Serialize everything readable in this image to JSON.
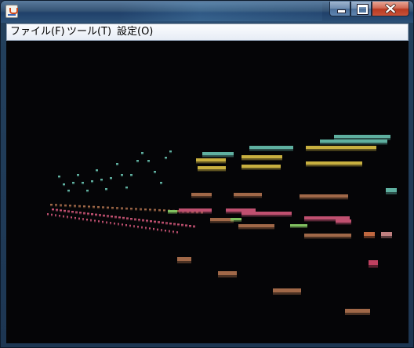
{
  "window": {
    "title": ""
  },
  "menu": {
    "items": [
      {
        "id": "file",
        "label": "ファイル(F)"
      },
      {
        "id": "tools",
        "label": "ツール(T)"
      },
      {
        "id": "settings",
        "label": "設定(O)"
      }
    ]
  },
  "icons": {
    "app": "java-cup-icon",
    "minimize": "minimize-icon",
    "maximize": "maximize-icon",
    "close": "close-icon"
  },
  "visualization": {
    "type": "3d-note-visualizer",
    "background": "#050507",
    "track_colors": [
      "#5fb0a0",
      "#c8b040",
      "#a06848",
      "#c05070",
      "#80c060"
    ]
  }
}
